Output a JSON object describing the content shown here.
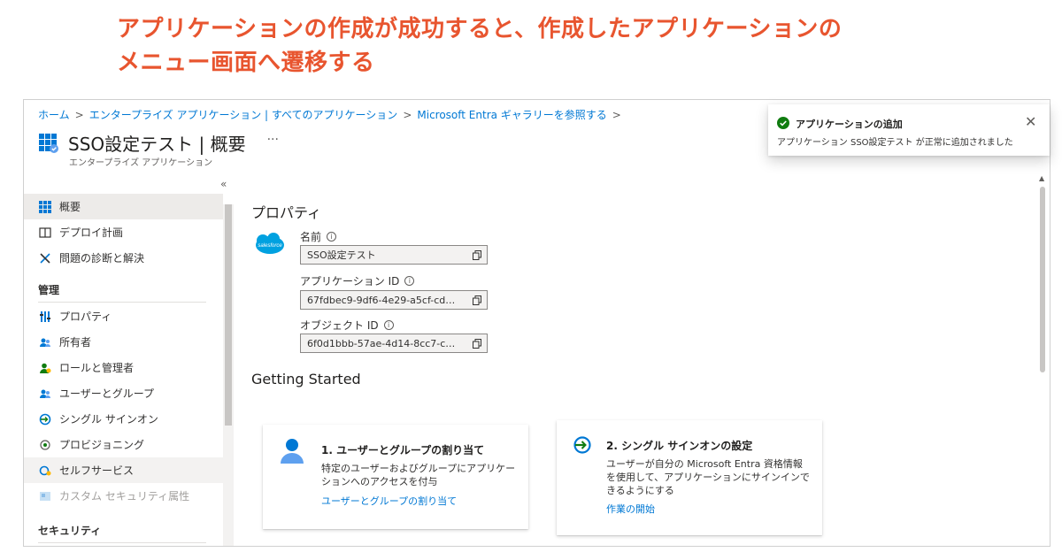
{
  "caption": {
    "line1": "アプリケーションの作成が成功すると、作成したアプリケーションの",
    "line2": "メニュー画面へ遷移する"
  },
  "breadcrumb": {
    "home": "ホーム",
    "enterprise_apps": "エンタープライズ アプリケーション | すべてのアプリケーション",
    "gallery": "Microsoft Entra ギャラリーを参照する",
    "separator": ">"
  },
  "header": {
    "title": "SSO設定テスト | 概要",
    "more": "···",
    "subtitle": "エンタープライズ アプリケーション",
    "collapse": "«"
  },
  "sidebar": {
    "items": [
      {
        "label": "概要",
        "icon": "grid-icon"
      },
      {
        "label": "デプロイ計画",
        "icon": "book-icon"
      },
      {
        "label": "問題の診断と解決",
        "icon": "wrench-icon"
      }
    ],
    "section_manage": "管理",
    "manage_items": [
      {
        "label": "プロパティ",
        "icon": "properties-icon"
      },
      {
        "label": "所有者",
        "icon": "owners-icon"
      },
      {
        "label": "ロールと管理者",
        "icon": "roles-icon"
      },
      {
        "label": "ユーザーとグループ",
        "icon": "users-groups-icon"
      },
      {
        "label": "シングル サインオン",
        "icon": "sso-icon"
      },
      {
        "label": "プロビジョニング",
        "icon": "provisioning-icon"
      },
      {
        "label": "セルフサービス",
        "icon": "self-service-icon"
      },
      {
        "label": "カスタム セキュリティ属性",
        "icon": "custom-attr-icon"
      }
    ],
    "section_security": "セキュリティ"
  },
  "properties": {
    "heading": "プロパティ",
    "name_label": "名前",
    "name_value": "SSO設定テスト",
    "appid_label": "アプリケーション ID",
    "appid_value": "67fdbec9-9df6-4e29-a5cf-cd…",
    "objectid_label": "オブジェクト ID",
    "objectid_value": "6f0d1bbb-57ae-4d14-8cc7-c…",
    "logo_text": "salesforce"
  },
  "getting_started": {
    "heading": "Getting Started",
    "card1": {
      "title": "1. ユーザーとグループの割り当て",
      "desc": "特定のユーザーおよびグループにアプリケーションへのアクセスを付与",
      "link": "ユーザーとグループの割り当て"
    },
    "card2": {
      "title": "2. シングル サインオンの設定",
      "desc": "ユーザーが自分の Microsoft Entra 資格情報を使用して、アプリケーションにサインインできるようにする",
      "link": "作業の開始"
    }
  },
  "toast": {
    "title": "アプリケーションの追加",
    "message": "アプリケーション SSO設定テスト が正常に追加されました",
    "close": "✕"
  },
  "colors": {
    "caption": "#e8552f",
    "link": "#0078d4",
    "success": "#107c10",
    "selected": "#edebe9"
  }
}
